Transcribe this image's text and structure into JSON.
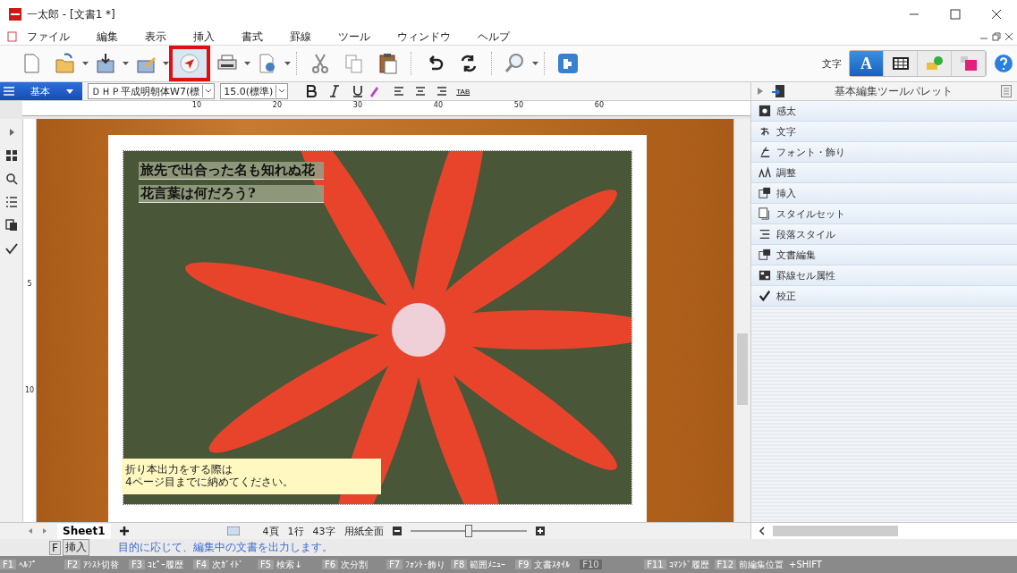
{
  "window": {
    "title": "一太郎 - [文書1 *]"
  },
  "menu": [
    "ファイル",
    "編集",
    "表示",
    "挿入",
    "書式",
    "罫線",
    "ツール",
    "ウィンドウ",
    "ヘルプ"
  ],
  "toolbar": [
    {
      "kind": "new",
      "highlighted": false
    },
    {
      "kind": "open",
      "highlighted": false
    },
    {
      "kind": "save",
      "highlighted": false
    },
    {
      "kind": "edit",
      "highlighted": false
    },
    {
      "kind": "navigate",
      "highlighted": true
    },
    {
      "kind": "print",
      "highlighted": false
    },
    {
      "kind": "settings",
      "highlighted": false
    },
    {
      "kind": "cut",
      "highlighted": false
    },
    {
      "kind": "copy",
      "highlighted": false
    },
    {
      "kind": "paste",
      "highlighted": false
    },
    {
      "kind": "undo",
      "highlighted": false
    },
    {
      "kind": "redo",
      "highlighted": false
    },
    {
      "kind": "zoom",
      "highlighted": false
    },
    {
      "kind": "plugin",
      "highlighted": false
    }
  ],
  "mode": {
    "label": "文字",
    "buttons": [
      {
        "kind": "text",
        "glyph": "A",
        "selected": true
      },
      {
        "kind": "table",
        "selected": false
      },
      {
        "kind": "shape",
        "selected": false
      },
      {
        "kind": "flower",
        "selected": false
      }
    ]
  },
  "format_bar": {
    "style": "基本",
    "font": "ＤＨＰ平成明朝体W7(標",
    "size": "15.0(標準)",
    "tab": "TAB"
  },
  "ruler": {
    "ticks": [
      "10",
      "20",
      "30",
      "40",
      "50",
      "60"
    ],
    "vertical_ticks": [
      "5",
      "10"
    ]
  },
  "document": {
    "heading": [
      "旅先で出合った名も知れぬ花",
      "花言葉は何だろう?"
    ],
    "note": [
      "折り本出力をする際は",
      "4ページ目までに納めてください。"
    ]
  },
  "palette": {
    "title": "基本編集ツールパレット",
    "items": [
      {
        "kind": "kanta",
        "label": "感太"
      },
      {
        "kind": "moji",
        "label": "文字"
      },
      {
        "kind": "font",
        "label": "フォント・飾り"
      },
      {
        "kind": "adjust",
        "label": "調整"
      },
      {
        "kind": "insert",
        "label": "挿入"
      },
      {
        "kind": "styleset",
        "label": "スタイルセット"
      },
      {
        "kind": "paragraph",
        "label": "段落スタイル"
      },
      {
        "kind": "docedit",
        "label": "文書編集"
      },
      {
        "kind": "cell",
        "label": "罫線セル属性"
      },
      {
        "kind": "proof",
        "label": "校正"
      }
    ]
  },
  "status": {
    "sheet": "Sheet1",
    "page": "4頁",
    "line": "1行",
    "chars": "43字",
    "view": "用紙全面",
    "level": 0.5
  },
  "message": {
    "key": "F",
    "mode": "挿入",
    "text": "目的に応じて、編集中の文書を出力します。"
  },
  "fkeys": [
    {
      "key": "F1",
      "label": "ﾍﾙﾌﾟ",
      "disabled": false
    },
    {
      "key": "F2",
      "label": "ｱｼｽﾄ切替",
      "disabled": false
    },
    {
      "key": "F3",
      "label": "ｺﾋﾟｰ履歴",
      "disabled": false
    },
    {
      "key": "F4",
      "label": "次ｶﾞｲﾄﾞ",
      "disabled": false
    },
    {
      "key": "F5",
      "label": "検索↓",
      "disabled": false
    },
    {
      "key": "F6",
      "label": "次分割",
      "disabled": false
    },
    {
      "key": "F7",
      "label": "ﾌｫﾝﾄ･飾り",
      "disabled": false
    },
    {
      "key": "F8",
      "label": "範囲ﾒﾆｭｰ",
      "disabled": false
    },
    {
      "key": "F9",
      "label": "文書ｽﾀｲﾙ",
      "disabled": false
    },
    {
      "key": "F10",
      "disabled": true
    },
    {
      "key": "F11",
      "label": "ｺﾏﾝﾄﾞ履歴",
      "disabled": false
    },
    {
      "key": "F12",
      "label": "前編集位置",
      "disabled": false
    }
  ],
  "shift": "+SHIFT"
}
